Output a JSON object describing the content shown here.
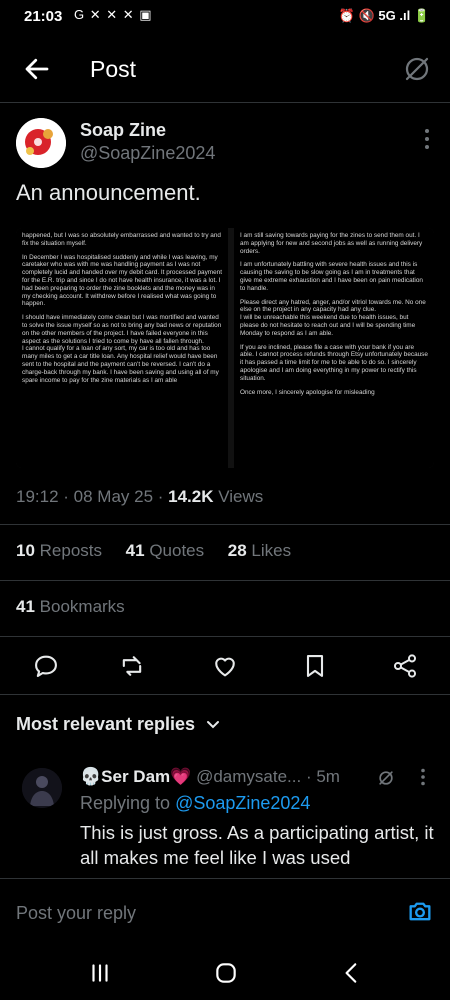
{
  "status_bar": {
    "time": "21:03",
    "left_icons": "G ✕ ✕ ✕ ▣",
    "right_text": "⏰ 🔇 5G .ıl 🔋"
  },
  "header": {
    "title": "Post"
  },
  "post": {
    "author_name": "Soap Zine",
    "author_handle": "@SoapZine2024",
    "text": "An announcement.",
    "attachment": {
      "left_column": [
        "happened, but I was so absolutely embarrassed and wanted to try and fix the situation myself.",
        "In December I was hospitalised suddenly and while I was leaving, my caretaker who was with me was handling payment as I was not completely lucid and handed over my debit card. It processed payment for the E.R. trip and since I do not have health insurance, it was a lot. I had been preparing to order the zine booklets and the money was in my checking account. It withdrew before I realised what was going to happen.",
        "I should have immediately come clean but I was mortified and wanted to solve the issue myself so as not to bring any bad news or reputation on the other members of the project. I have failed everyone in this aspect as the solutions I tried to come by have all fallen through.\nI cannot qualify for a loan of any sort, my car is too old and has too many miles to get a car title loan. Any hospital relief would have been sent to the hospital and the payment can't be reversed. I can't do a charge-back through my bank. I have been saving and using all of my spare income to pay for the zine materials as I am able"
      ],
      "right_column": [
        "I am still saving towards paying for the zines to send them out. I am applying for new and second jobs as well as running delivery orders.",
        "I am unfortunately battling with severe health issues and this is causing the saving to be slow going as I am in treatments that give me extreme exhaustion and I have been on pain medication to handle.",
        "Please direct any hatred, anger, and/or vitriol towards me. No one else on the project in any capacity had any clue.\nI will be unreachable this weekend due to health issues, but please do not hesitate to reach out and I will be spending time Monday to respond as I am able.",
        "If you are inclined, please file a case with your bank if you are able. I cannot process refunds through Etsy unfortunately because it has passed a time limit for me to be able to do so. I sincerely apologise and I am doing everything in my power to rectify this situation.",
        "Once more, I sincerely apologise for misleading"
      ]
    },
    "timestamp": "19:12 · 08 May 25 · ",
    "views_count": "14.2K",
    "views_label": " Views",
    "reposts_count": "10",
    "reposts_label": "Reposts",
    "quotes_count": "41",
    "quotes_label": "Quotes",
    "likes_count": "28",
    "likes_label": "Likes",
    "bookmarks_count": "41",
    "bookmarks_label": "Bookmarks"
  },
  "replies": {
    "sort_label": "Most relevant replies",
    "items": [
      {
        "name": "💀Ser Dam💗",
        "handle": "@damysate...",
        "time": "· 5m",
        "replying_prefix": "Replying to ",
        "replying_handle": "@SoapZine2024",
        "text": "This is just gross. As a participating artist, it all makes me feel like I was used"
      }
    ]
  },
  "composer": {
    "placeholder": "Post your reply"
  },
  "colors": {
    "accent": "#1d9bf0",
    "muted": "#71767b",
    "text": "#e7e9ea",
    "background": "#000000"
  }
}
